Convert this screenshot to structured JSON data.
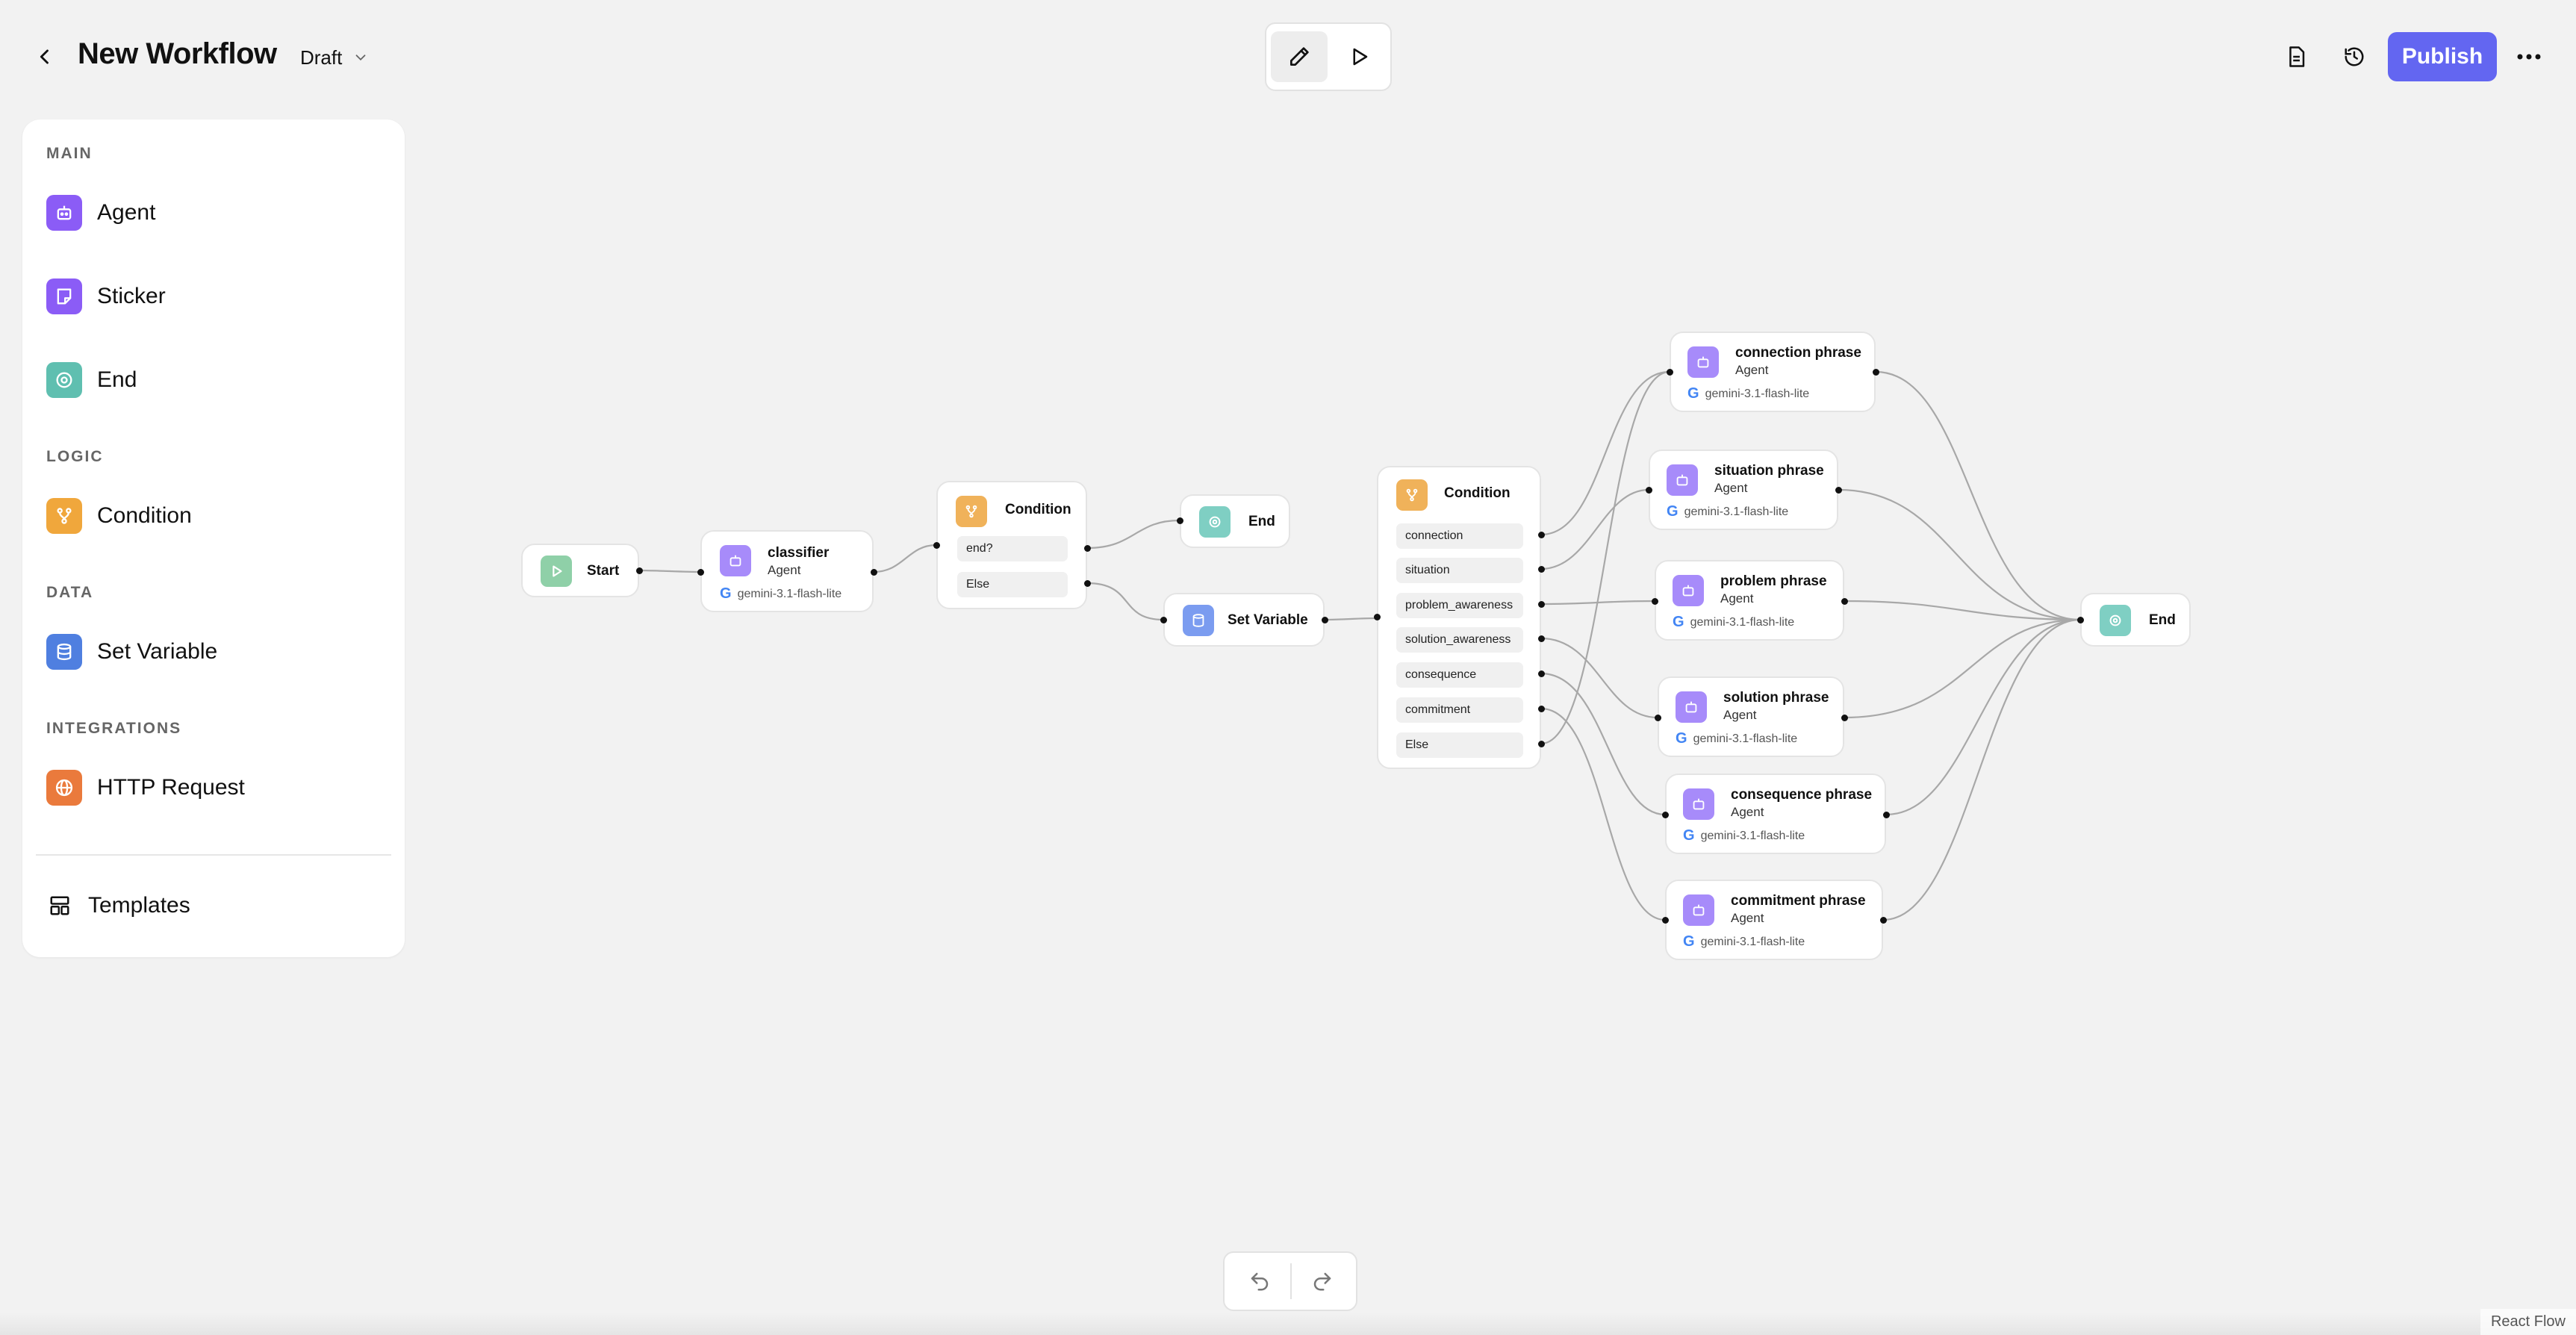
{
  "header": {
    "title": "New Workflow",
    "status": "Draft",
    "publish_label": "Publish"
  },
  "sidebar": {
    "sections": [
      {
        "heading": "MAIN",
        "items": [
          {
            "label": "Agent",
            "color": "#8b5cf6",
            "icon": "robot-icon"
          },
          {
            "label": "Sticker",
            "color": "#8b5cf6",
            "icon": "sticker-icon"
          },
          {
            "label": "End",
            "color": "#5fbfb0",
            "icon": "stop-circle-icon"
          }
        ]
      },
      {
        "heading": "LOGIC",
        "items": [
          {
            "label": "Condition",
            "color": "#f0a73c",
            "icon": "branch-icon"
          }
        ]
      },
      {
        "heading": "DATA",
        "items": [
          {
            "label": "Set Variable",
            "color": "#4f7fe0",
            "icon": "database-icon"
          }
        ]
      },
      {
        "heading": "INTEGRATIONS",
        "items": [
          {
            "label": "HTTP Request",
            "color": "#ea7a3c",
            "icon": "globe-icon"
          }
        ]
      }
    ],
    "templates_label": "Templates"
  },
  "nodes": {
    "start": {
      "label": "Start"
    },
    "classifier": {
      "label": "classifier",
      "type": "Agent",
      "model": "gemini-3.1-flash-lite"
    },
    "condition1": {
      "label": "Condition",
      "branches": [
        "end?",
        "Else"
      ]
    },
    "end1": {
      "label": "End"
    },
    "setvar": {
      "label": "Set Variable"
    },
    "condition2": {
      "label": "Condition",
      "branches": [
        "connection",
        "situation",
        "problem_awareness",
        "solution_awareness",
        "consequence",
        "commitment",
        "Else"
      ]
    },
    "agents": [
      {
        "label": "connection phrase",
        "type": "Agent",
        "model": "gemini-3.1-flash-lite"
      },
      {
        "label": "situation phrase",
        "type": "Agent",
        "model": "gemini-3.1-flash-lite"
      },
      {
        "label": "problem phrase",
        "type": "Agent",
        "model": "gemini-3.1-flash-lite"
      },
      {
        "label": "solution phrase",
        "type": "Agent",
        "model": "gemini-3.1-flash-lite"
      },
      {
        "label": "consequence phrase",
        "type": "Agent",
        "model": "gemini-3.1-flash-lite"
      },
      {
        "label": "commitment phrase",
        "type": "Agent",
        "model": "gemini-3.1-flash-lite"
      }
    ],
    "end2": {
      "label": "End"
    }
  },
  "colors": {
    "agent": "#a78bfa",
    "condition": "#f0b25a",
    "end": "#7fcfc3",
    "start": "#8fd0a8",
    "setvar": "#7b9cf0",
    "publish": "#6366f1"
  },
  "footer": {
    "attribution": "React Flow"
  }
}
